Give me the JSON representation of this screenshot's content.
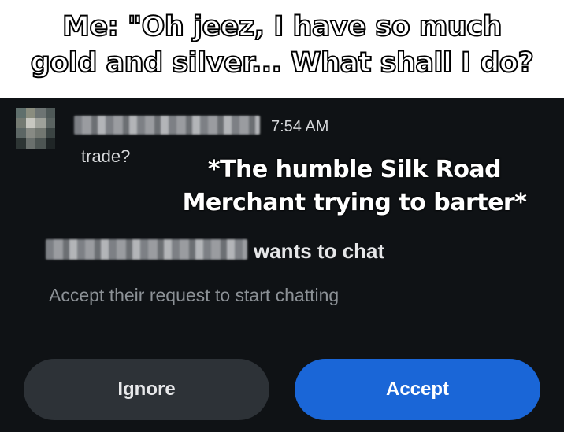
{
  "meme": {
    "top_caption_line1": "Me: \"Oh jeez, I have so much",
    "top_caption_line2": "gold and silver... What shall I do?",
    "overlay_line1": "*The humble Silk Road",
    "overlay_line2": "Merchant trying to barter*"
  },
  "chat": {
    "timestamp": "7:54 AM",
    "last_message": "trade?",
    "request_text": "wants to chat",
    "request_subtext": "Accept their request to start chatting"
  },
  "buttons": {
    "ignore_label": "Ignore",
    "accept_label": "Accept"
  },
  "colors": {
    "background": "#0f1215",
    "accept": "#1a66d7",
    "ignore": "#2d3237"
  }
}
